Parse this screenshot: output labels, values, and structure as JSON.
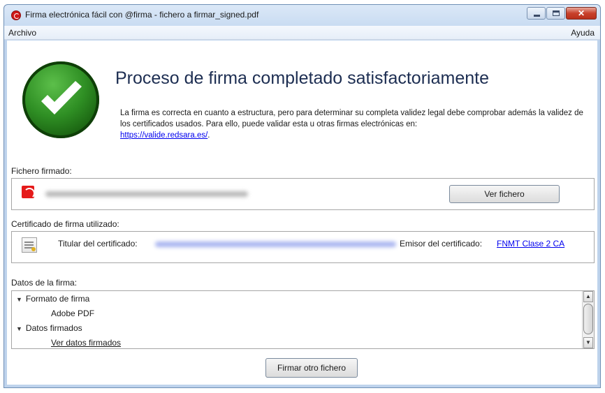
{
  "window": {
    "title": "Firma electrónica fácil con @firma - fichero a firmar_signed.pdf"
  },
  "menu": {
    "file": "Archivo",
    "help": "Ayuda"
  },
  "status": {
    "headline": "Proceso de firma completado satisfactoriamente",
    "description": "La firma es correcta en cuanto a estructura, pero para determinar su completa validez legal debe comprobar además la validez de los certificados usados. Para ello, puede validar esta u otras firmas electrónicas en:",
    "link": "https://valide.redsara.es/",
    "link_suffix": "."
  },
  "signed_file": {
    "label": "Fichero firmado:",
    "view_button": "Ver fichero"
  },
  "certificate": {
    "label": "Certificado de firma utilizado:",
    "holder_label": "Titular del certificado:",
    "issuer_label": "Emisor del certificado:",
    "issuer_value": "FNMT Clase 2 CA"
  },
  "signature_data": {
    "label": "Datos de la firma:",
    "tree": [
      {
        "label": "Formato de firma",
        "expanded": true
      },
      {
        "label": "Adobe PDF"
      },
      {
        "label": "Datos firmados",
        "expanded": true
      },
      {
        "label": "Ver datos firmados"
      }
    ]
  },
  "actions": {
    "sign_another": "Firmar otro fichero"
  },
  "colors": {
    "headline": "#1d2e52",
    "link": "#0000ee",
    "success_green": "#2f8f24",
    "pdf_red": "#e51a1a"
  }
}
